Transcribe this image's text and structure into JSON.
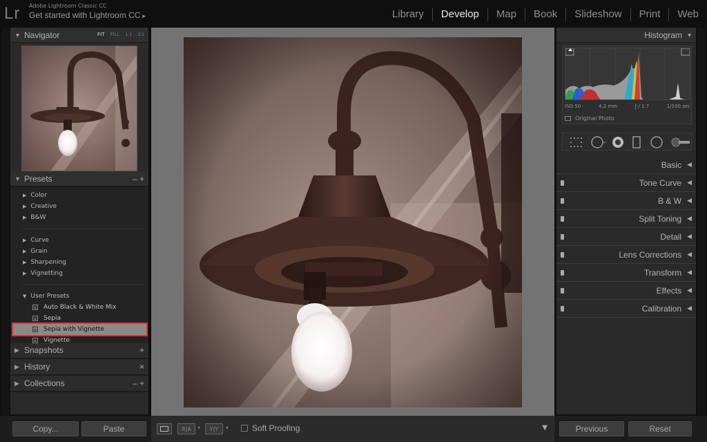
{
  "app": {
    "logo": "Lr",
    "name": "Adobe Lightroom Classic CC",
    "subtitle": "Get started with Lightroom CC",
    "subtitle_arrow": "▸"
  },
  "modules": [
    {
      "label": "Library",
      "active": false
    },
    {
      "label": "Develop",
      "active": true
    },
    {
      "label": "Map",
      "active": false
    },
    {
      "label": "Book",
      "active": false
    },
    {
      "label": "Slideshow",
      "active": false
    },
    {
      "label": "Print",
      "active": false
    },
    {
      "label": "Web",
      "active": false
    }
  ],
  "navigator": {
    "title": "Navigator",
    "zoom_options": [
      "FIT",
      "FILL",
      "1:1",
      "3:1"
    ],
    "active_zoom": "FIT"
  },
  "presets": {
    "title": "Presets",
    "actions": "–  +",
    "folders_group1": [
      "Color",
      "Creative",
      "B&W"
    ],
    "folders_group2": [
      "Curve",
      "Grain",
      "Sharpening",
      "Vignetting"
    ],
    "user_folder": "User Presets",
    "user_items": [
      "Auto Black & White Mix",
      "Sepia",
      "Sepia with Vignette",
      "Vignette"
    ],
    "selected_item": "Sepia with Vignette"
  },
  "left_panels": {
    "snapshots": {
      "title": "Snapshots",
      "action": "+"
    },
    "history": {
      "title": "History",
      "action": "×"
    },
    "collections": {
      "title": "Collections",
      "action": "–  +"
    }
  },
  "histogram": {
    "title": "Histogram",
    "iso": "ISO 50",
    "focal": "4.2 mm",
    "aperture": "ƒ / 1.7",
    "shutter": "1/100 sec",
    "original_photo_label": "Original Photo"
  },
  "develop_panels": [
    {
      "label": "Basic",
      "switch": false
    },
    {
      "label": "Tone Curve",
      "switch": true
    },
    {
      "label": "B & W",
      "switch": true
    },
    {
      "label": "Split Toning",
      "switch": true
    },
    {
      "label": "Detail",
      "switch": true
    },
    {
      "label": "Lens Corrections",
      "switch": true
    },
    {
      "label": "Transform",
      "switch": true
    },
    {
      "label": "Effects",
      "switch": true
    },
    {
      "label": "Calibration",
      "switch": true
    }
  ],
  "bottom": {
    "copy_label": "Copy...",
    "paste_label": "Paste",
    "soft_proofing_label": "Soft Proofing",
    "previous_label": "Previous",
    "reset_label": "Reset"
  },
  "colors": {
    "accent_selected_outline": "#e0323a",
    "panel_bg": "#2a2a2a",
    "center_bg": "#737373"
  }
}
